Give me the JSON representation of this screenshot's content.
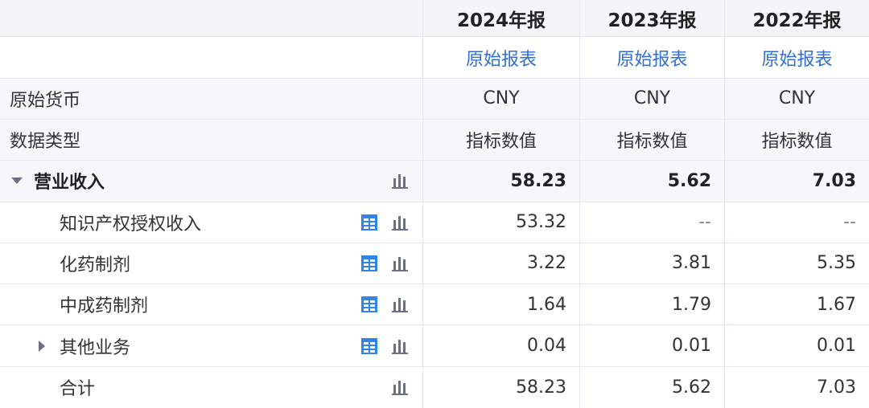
{
  "columns": [
    {
      "year": "2024年报",
      "report_link": "原始报表",
      "currency": "CNY",
      "data_type": "指标数值"
    },
    {
      "year": "2023年报",
      "report_link": "原始报表",
      "currency": "CNY",
      "data_type": "指标数值"
    },
    {
      "year": "2022年报",
      "report_link": "原始报表",
      "currency": "CNY",
      "data_type": "指标数值"
    }
  ],
  "labels": {
    "currency": "原始货币",
    "data_type": "数据类型"
  },
  "rows": [
    {
      "label": "营业收入",
      "values": [
        "58.23",
        "5.62",
        "7.03"
      ]
    },
    {
      "label": "知识产权授权收入",
      "values": [
        "53.32",
        "--",
        "--"
      ]
    },
    {
      "label": "化药制剂",
      "values": [
        "3.22",
        "3.81",
        "5.35"
      ]
    },
    {
      "label": "中成药制剂",
      "values": [
        "1.64",
        "1.79",
        "1.67"
      ]
    },
    {
      "label": "其他业务",
      "values": [
        "0.04",
        "0.01",
        "0.01"
      ]
    },
    {
      "label": "合计",
      "values": [
        "58.23",
        "5.62",
        "7.03"
      ]
    }
  ],
  "icons": {
    "table": "table-icon",
    "chart": "bar-chart-icon"
  },
  "colors": {
    "link": "#2f6fd6",
    "icon_blue": "#2f86e8",
    "icon_gray": "#6b7089",
    "header_bg": "#f4f5f9"
  }
}
